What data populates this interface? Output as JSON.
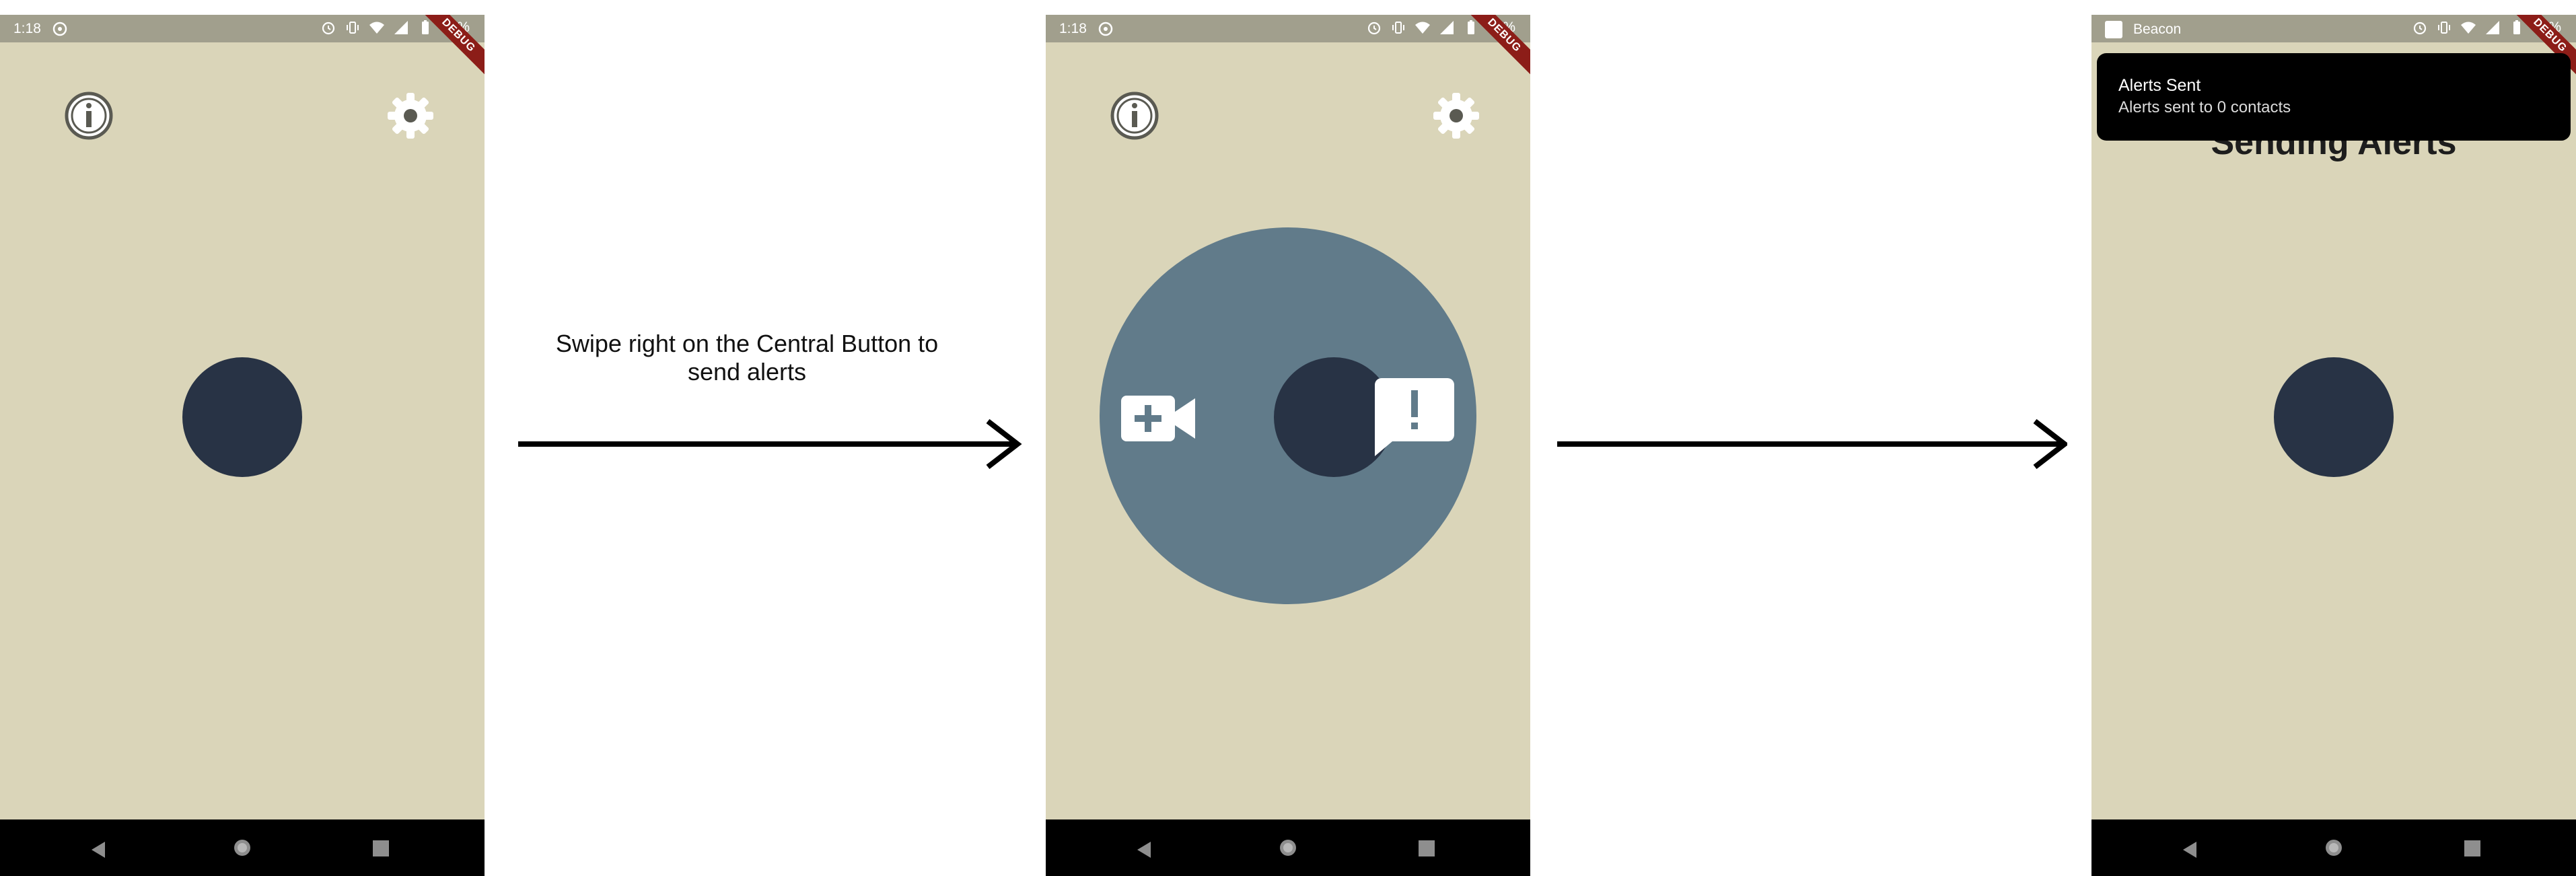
{
  "screens": {
    "home": {
      "status": {
        "time": "1:18",
        "battery": "97%"
      },
      "debug_banner": "DEBUG"
    },
    "swiping": {
      "status": {
        "time": "1:18",
        "battery": "97%"
      },
      "debug_banner": "DEBUG"
    },
    "sent": {
      "status": {
        "app_name": "Beacon",
        "battery": "99%"
      },
      "debug_banner": "DEBUG",
      "heading": "Sending Alerts",
      "notification": {
        "title": "Alerts Sent",
        "body": "Alerts sent to 0 contacts"
      }
    }
  },
  "instruction_text": "Swipe right on the Central Button to send alerts",
  "colors": {
    "app_background": "#dad5b9",
    "status_bar": "#a19f8d",
    "central_button": "#283345",
    "swipe_ring": "#617b8a",
    "nav_bar": "#000000",
    "debug_ribbon": "#8c1d18"
  },
  "icons": {
    "top_left": "info-icon",
    "top_right": "gear-icon",
    "swipe_left": "video-call-icon",
    "swipe_right": "alert-message-icon",
    "nav": [
      "back-icon",
      "home-icon",
      "recents-icon"
    ]
  }
}
